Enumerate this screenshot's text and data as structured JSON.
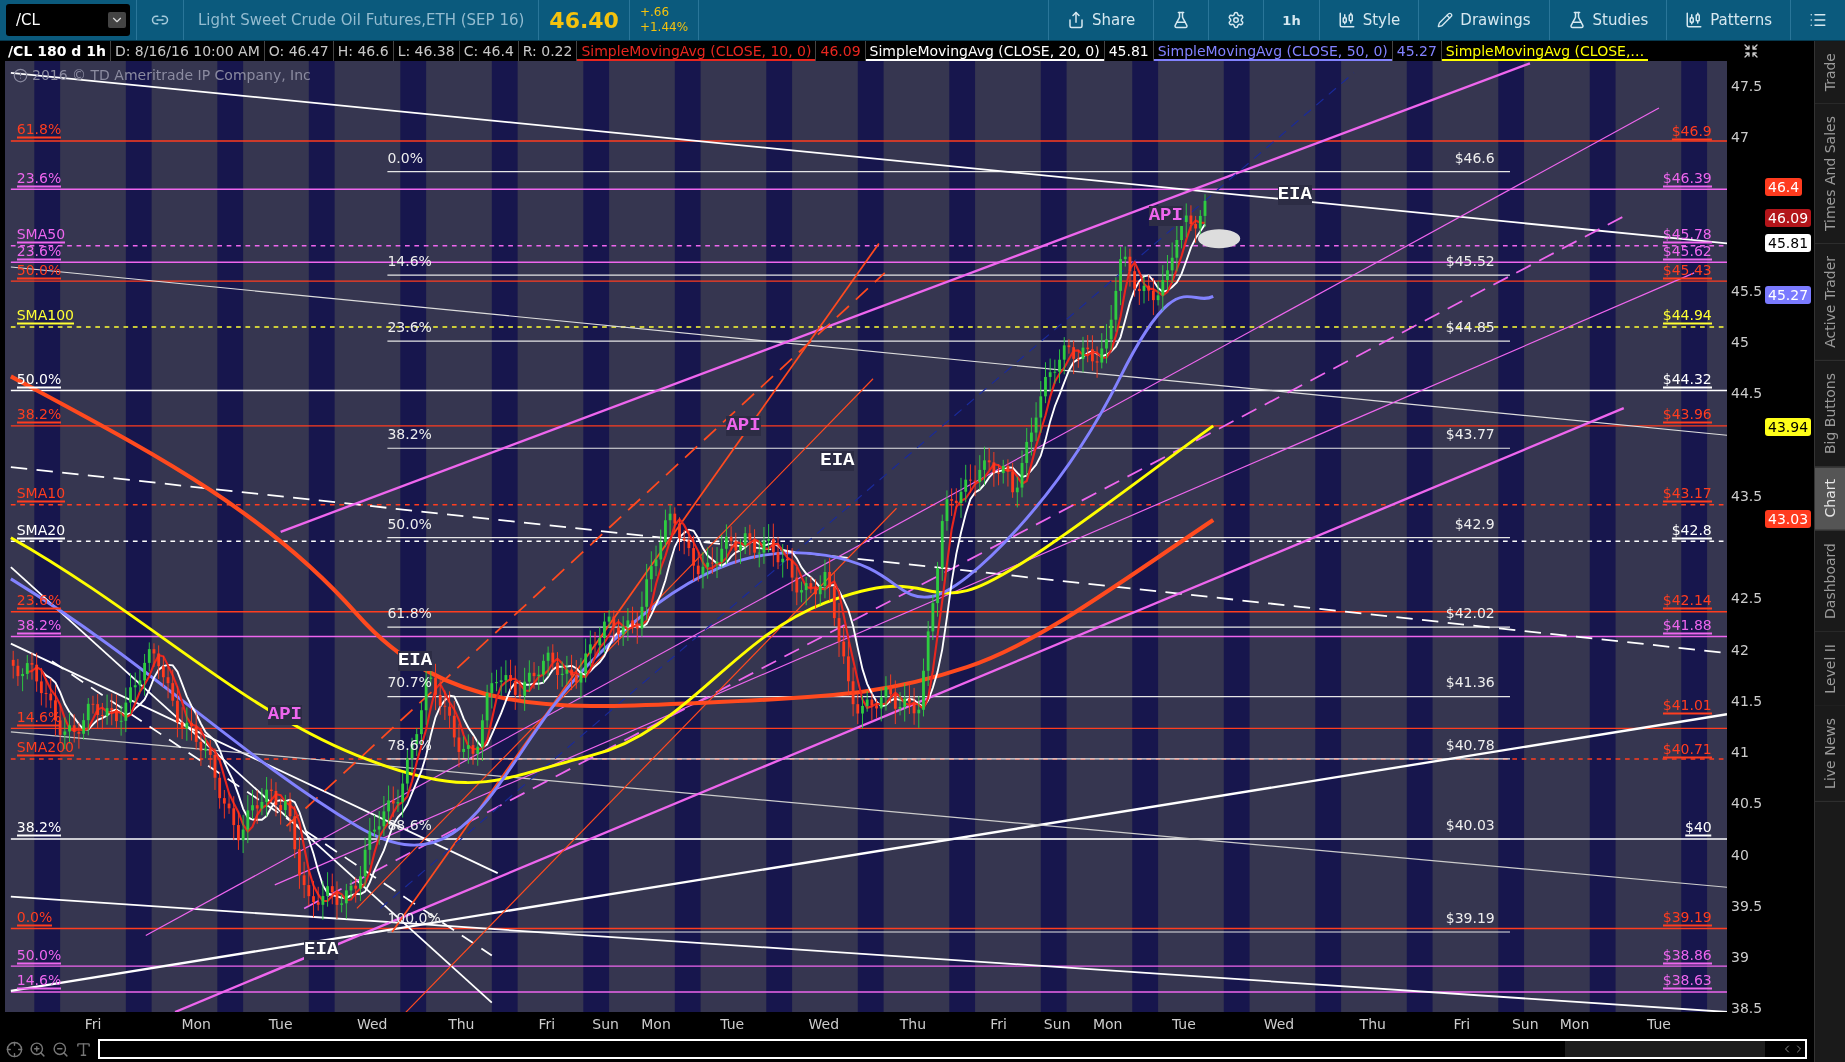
{
  "toolbar": {
    "symbol": "/CL",
    "description": "Light Sweet Crude Oil Futures,ETH (SEP 16)",
    "last": "46.40",
    "change": "+.66",
    "change_pct": "+1.44%",
    "buttons": [
      {
        "kind": "share",
        "label": "Share"
      },
      {
        "kind": "flask"
      },
      {
        "kind": "gear"
      },
      {
        "kind": "text",
        "label": "1h"
      },
      {
        "kind": "style",
        "label": "Style"
      },
      {
        "kind": "drawings",
        "label": "Drawings"
      },
      {
        "kind": "studies",
        "label": "Studies"
      },
      {
        "kind": "patterns",
        "label": "Patterns"
      },
      {
        "kind": "menu"
      }
    ]
  },
  "legend": {
    "title": "/CL 180 d 1h",
    "fields": [
      "D: 8/16/16 10:00 AM",
      "O: 46.47",
      "H: 46.6",
      "L: 46.38",
      "C: 46.4",
      "R: 0.22"
    ],
    "studies": [
      {
        "name": "SimpleMovingAvg (CLOSE, 10, 0)",
        "value": "46.09",
        "color": "#e8261f"
      },
      {
        "name": "SimpleMovingAvg (CLOSE, 20, 0)",
        "value": "45.81",
        "color": "#ffffff"
      },
      {
        "name": "SimpleMovingAvg (CLOSE, 50, 0)",
        "value": "45.27",
        "color": "#8282ff"
      },
      {
        "name": "SimpleMovingAvg (CLOSE,…",
        "color": "#ffff00"
      }
    ]
  },
  "chart": {
    "copyright": "2016 © TD Ameritrade IP Company, Inc",
    "left_labels": [
      {
        "text": "61.8%",
        "color": "#ff3d1f"
      },
      {
        "text": "23.6%",
        "color": "#ee66ee"
      },
      {
        "text": "SMA50",
        "color": "#ee66ee"
      },
      {
        "text": "23.6%",
        "color": "#ee66ee"
      },
      {
        "text": "50.0%",
        "color": "#ff3d1f"
      },
      {
        "text": "SMA100",
        "color": "#ffff33"
      },
      {
        "text": "50.0%",
        "color": "#ffffff"
      },
      {
        "text": "38.2%",
        "color": "#ff3d1f"
      },
      {
        "text": "SMA10",
        "color": "#ff3d1f"
      },
      {
        "text": "SMA20",
        "color": "#ffffff"
      },
      {
        "text": "23.6%",
        "color": "#ff3d1f"
      },
      {
        "text": "38.2%",
        "color": "#ee66ee"
      },
      {
        "text": "14.6%",
        "color": "#ff3d1f"
      },
      {
        "text": "SMA200",
        "color": "#ff3d1f"
      },
      {
        "text": "38.2%",
        "color": "#ffffff"
      },
      {
        "text": "0.0%",
        "color": "#ff3d1f"
      },
      {
        "text": "50.0%",
        "color": "#ee66ee"
      },
      {
        "text": "14.6%",
        "color": "#ee66ee"
      }
    ],
    "fib_levels": [
      {
        "percent": "0.0%",
        "price": "$46.6"
      },
      {
        "percent": "14.6%",
        "price": "$45.52"
      },
      {
        "percent": "23.6%",
        "price": "$44.85"
      },
      {
        "percent": "38.2%",
        "price": "$43.77"
      },
      {
        "percent": "50.0%",
        "price": "$42.9"
      },
      {
        "percent": "61.8%",
        "price": "$42.02"
      },
      {
        "percent": "70.7%",
        "price": "$41.36"
      },
      {
        "percent": "78.6%",
        "price": "$40.78"
      },
      {
        "percent": "88.6%",
        "price": "$40.03"
      },
      {
        "percent": "100.0%",
        "price": "$39.19"
      }
    ],
    "right_labels": [
      {
        "text": "$46.9",
        "color": "#ff3d1f"
      },
      {
        "text": "$46.39",
        "color": "#ee66ee"
      },
      {
        "text": "$45.78",
        "color": "#ee66ee"
      },
      {
        "text": "$45.62",
        "color": "#ee66ee"
      },
      {
        "text": "$45.43",
        "color": "#ff3d1f"
      },
      {
        "text": "$44.94",
        "color": "#ffff33"
      },
      {
        "text": "$44.32",
        "color": "#ffffff"
      },
      {
        "text": "$43.96",
        "color": "#ff3d1f"
      },
      {
        "text": "$43.17",
        "color": "#ff3d1f"
      },
      {
        "text": "$42.8",
        "color": "#ffffff"
      },
      {
        "text": "$42.14",
        "color": "#ff3d1f"
      },
      {
        "text": "$41.88",
        "color": "#ee66ee"
      },
      {
        "text": "$41.01",
        "color": "#ff3d1f"
      },
      {
        "text": "$40.71",
        "color": "#ff3d1f"
      },
      {
        "text": "$40",
        "color": "#ffffff"
      },
      {
        "text": "$39.19",
        "color": "#ff3d1f"
      },
      {
        "text": "$38.86",
        "color": "#ee66ee"
      },
      {
        "text": "$38.63",
        "color": "#ee66ee"
      }
    ],
    "events": [
      {
        "text": "API",
        "color": "#ee66ee"
      },
      {
        "text": "EIA",
        "color": "#ffffff"
      },
      {
        "text": "API",
        "color": "#ee66ee"
      },
      {
        "text": "EIA",
        "color": "#ffffff"
      },
      {
        "text": "EIA",
        "color": "#ffffff"
      },
      {
        "text": "API",
        "color": "#ee66ee"
      },
      {
        "text": "EIA",
        "color": "#ffffff"
      }
    ],
    "price_axis": [
      "47.5",
      "47",
      "45.5",
      "45",
      "44.5",
      "43.5",
      "42.5",
      "42",
      "41.5",
      "41",
      "40.5",
      "40",
      "39.5",
      "39",
      "38.5"
    ],
    "price_badges": [
      {
        "text": "46.4",
        "color": "#ff3b1e"
      },
      {
        "text": "46.09",
        "color": "#b3151a"
      },
      {
        "text": "45.81",
        "color": "#ffffff"
      },
      {
        "text": "45.27",
        "color": "#7a7aff"
      },
      {
        "text": "43.94",
        "color": "#ffff1a"
      },
      {
        "text": "43.03",
        "color": "#ff3b1e"
      }
    ],
    "time_axis": [
      "Fri",
      "Mon",
      "Tue",
      "Wed",
      "Thu",
      "Fri",
      "Sun",
      "Mon",
      "Tue",
      "Wed",
      "Thu",
      "Fri",
      "Sun",
      "Mon",
      "Tue",
      "Wed",
      "Thu",
      "Fri",
      "Sun",
      "Mon",
      "Tue"
    ]
  },
  "side_tabs": [
    {
      "label": "Trade",
      "selected": false
    },
    {
      "label": "Times And Sales",
      "selected": false
    },
    {
      "label": "Active Trader",
      "selected": false
    },
    {
      "label": "Big Buttons",
      "selected": false
    },
    {
      "label": "Chart",
      "selected": true
    },
    {
      "label": "Dashboard",
      "selected": false
    },
    {
      "label": "Level II",
      "selected": false
    },
    {
      "label": "Live News",
      "selected": false
    }
  ]
}
